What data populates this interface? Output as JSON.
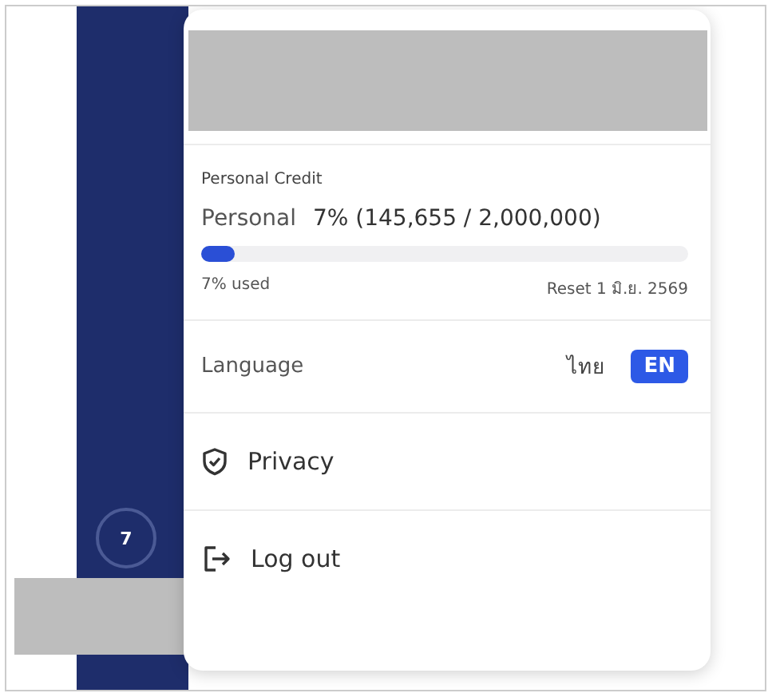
{
  "sidebar": {
    "badge": "7"
  },
  "menu": {
    "credit": {
      "heading": "Personal Credit",
      "label": "Personal",
      "summary": "7% (145,655 / 2,000,000)",
      "level": 0.07,
      "used": "7% used",
      "reset": "Reset 1 มิ.ย. 2569"
    },
    "language": {
      "label": "Language",
      "options": [
        {
          "label": "ไทย",
          "selected": false
        },
        {
          "label": "EN",
          "selected": true
        }
      ]
    },
    "items": [
      {
        "kind": "privacy",
        "label": "Privacy"
      },
      {
        "kind": "logout",
        "label": "Log out"
      }
    ]
  }
}
